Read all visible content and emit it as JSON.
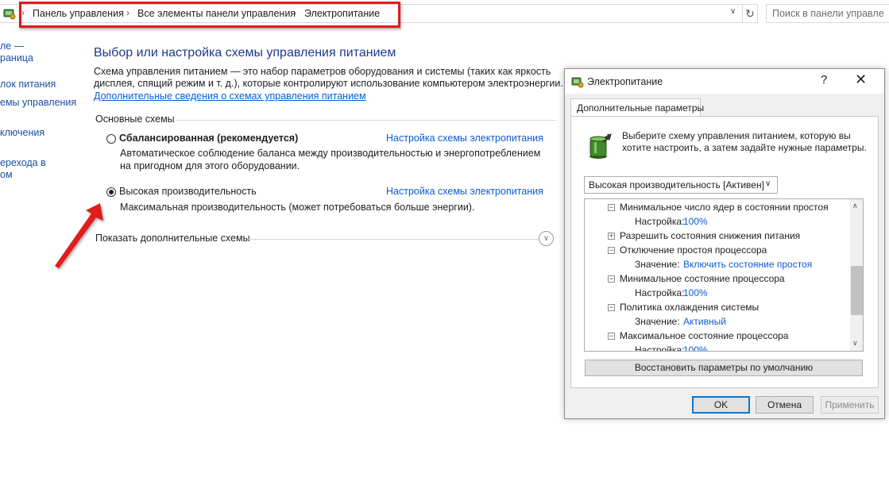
{
  "address_bar": {
    "breadcrumbs": [
      "Панель управления",
      "Все элементы панели управления",
      "Электропитание"
    ],
    "separator": "›",
    "search_placeholder": "Поиск в панели управле",
    "refresh_icon": "refresh-icon",
    "highlight_color": "#e01a1a"
  },
  "left_nav": {
    "items": [
      "ле —",
      "раница",
      "лок питания",
      "емы управления",
      "ключения",
      "ерехода в",
      "ом"
    ]
  },
  "main": {
    "title": "Выбор или настройка схемы управления питанием",
    "description_lines": [
      "Схема управления питанием — это набор параметров оборудования и системы (таких как яркость",
      "дисплея, спящий режим и т. д.), которые контролируют использование компьютером электроэнергии."
    ],
    "more_info_link": "Дополнительные сведения о схемах управления питанием",
    "section_label": "Основные схемы",
    "plans": [
      {
        "name": "Сбалансированная (рекомендуется)",
        "selected": false,
        "link": "Настройка схемы электропитания",
        "description_lines": [
          "Автоматическое соблюдение баланса между производительностью и энергопотреблением",
          "на пригодном для этого оборудовании."
        ]
      },
      {
        "name": "Высокая производительность",
        "selected": true,
        "link": "Настройка схемы электропитания",
        "description_lines": [
          "Максимальная производительность (может потребоваться больше энергии)."
        ]
      }
    ],
    "show_more": "Показать дополнительные схемы",
    "arrow_color": "#e01a1a"
  },
  "dialog": {
    "title": "Электропитание",
    "help": "?",
    "close": "✕",
    "tab": "Дополнительные параметры",
    "intro_lines": [
      "Выберите схему управления питанием, которую вы",
      "хотите настроить, а затем задайте нужные параметры."
    ],
    "plan_select_value": "Высокая производительность [Активен]",
    "tree": [
      {
        "type": "node",
        "expander": "−",
        "indent": 1,
        "label": "Минимальное число ядер в состоянии простоя"
      },
      {
        "type": "value",
        "indent": 2,
        "key": "Настройка:",
        "value": "100%"
      },
      {
        "type": "node",
        "expander": "+",
        "indent": 1,
        "label": "Разрешить состояния снижения питания"
      },
      {
        "type": "node",
        "expander": "−",
        "indent": 1,
        "label": "Отключение простоя процессора"
      },
      {
        "type": "value",
        "indent": 2,
        "key": "Значение:",
        "value": "Включить состояние простоя"
      },
      {
        "type": "node",
        "expander": "−",
        "indent": 1,
        "label": "Минимальное состояние процессора"
      },
      {
        "type": "value",
        "indent": 2,
        "key": "Настройка:",
        "value": "100%"
      },
      {
        "type": "node",
        "expander": "−",
        "indent": 1,
        "label": "Политика охлаждения системы"
      },
      {
        "type": "value",
        "indent": 2,
        "key": "Значение:",
        "value": "Активный"
      },
      {
        "type": "node",
        "expander": "−",
        "indent": 1,
        "label": "Максимальное состояние процессора"
      },
      {
        "type": "value",
        "indent": 2,
        "key": "Настройка:",
        "value": "100%"
      }
    ],
    "restore_button": "Восстановить параметры по умолчанию",
    "ok": "OK",
    "cancel": "Отмена",
    "apply": "Применить"
  }
}
